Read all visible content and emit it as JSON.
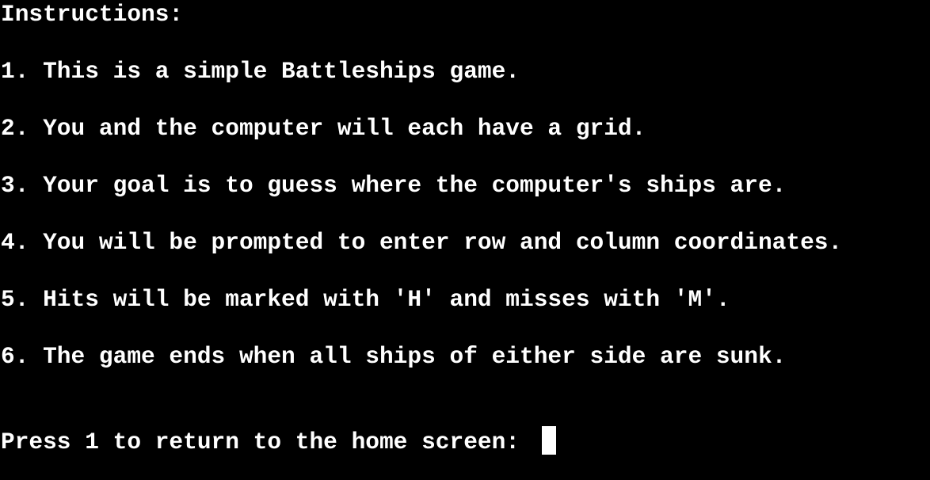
{
  "terminal": {
    "heading": "Instructions:",
    "instructions": [
      "1. This is a simple Battleships game.",
      "2. You and the computer will each have a grid.",
      "3. Your goal is to guess where the computer's ships are.",
      "4. You will be prompted to enter row and column coordinates.",
      "5. Hits will be marked with 'H' and misses with 'M'.",
      "6. The game ends when all ships of either side are sunk."
    ],
    "prompt": "Press 1 to return to the home screen: ",
    "colors": {
      "background": "#000000",
      "text": "#ffffff",
      "cursor": "#ffffff"
    }
  }
}
